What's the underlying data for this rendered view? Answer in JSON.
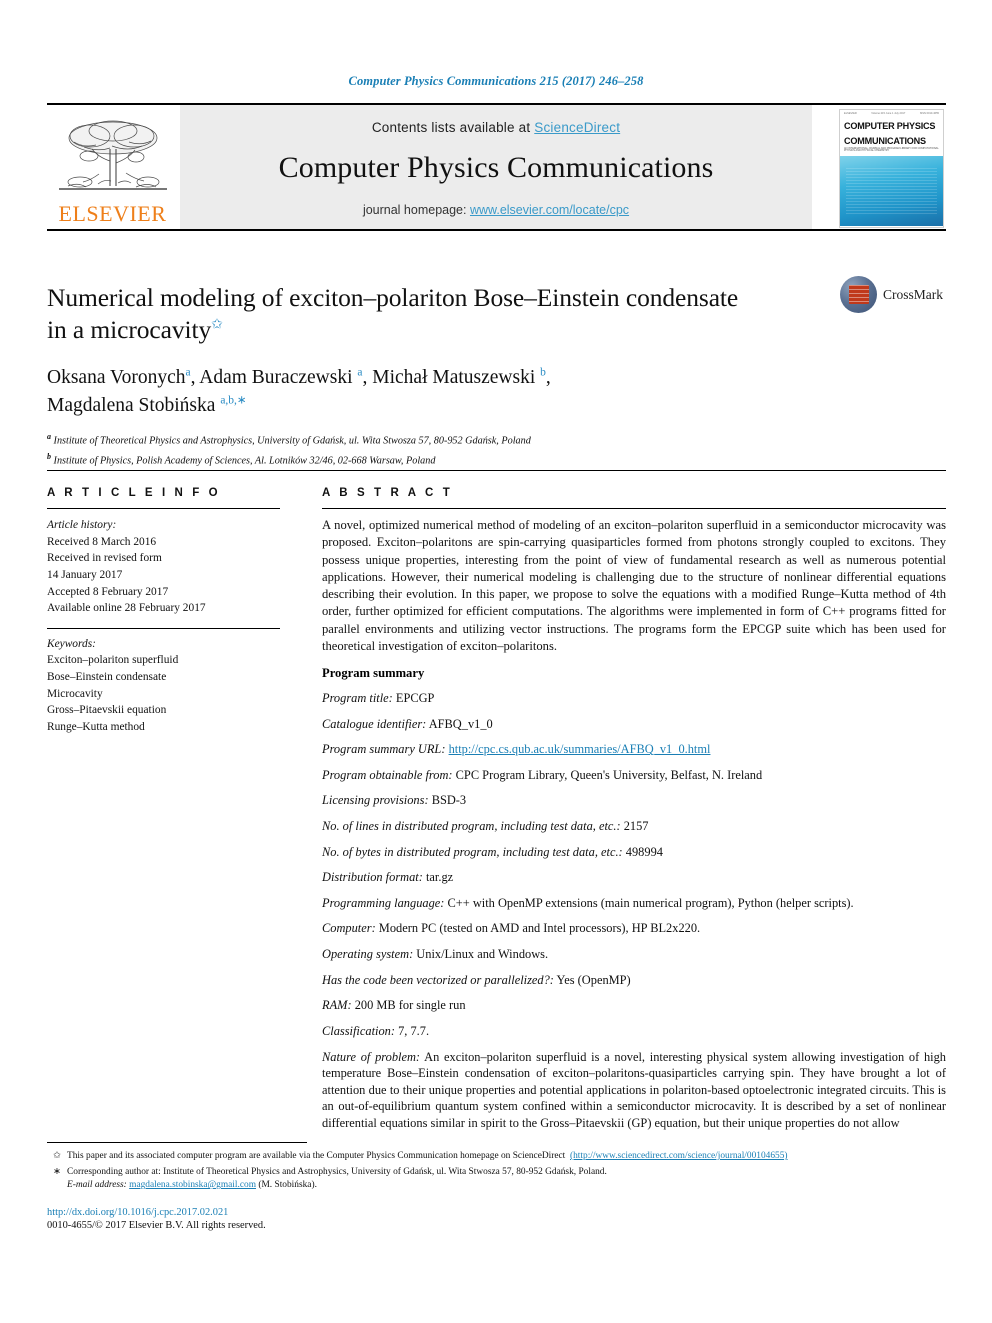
{
  "running_head": "Computer Physics Communications 215 (2017) 246–258",
  "masthead": {
    "publisher_name": "ELSEVIER",
    "contents_prefix": "Contents lists available at ",
    "contents_link": "ScienceDirect",
    "journal_name": "Computer Physics Communications",
    "homepage_prefix": "journal homepage: ",
    "homepage_link": "www.elsevier.com/locate/cpc",
    "cover": {
      "tiny_left": "ELSEVIER",
      "tiny_center": "Volume 215 June 1 July 2017",
      "tiny_right": "ISSN 0010-4655",
      "title_line1": "COMPUTER PHYSICS",
      "title_line2": "COMMUNICATIONS",
      "subtitle": "AN INTERNATIONAL JOURNAL AND PROGRAM LIBRARY FOR COMPUTATIONAL PHYSICS AND PHYSICAL CHEMISTRY"
    }
  },
  "article": {
    "title_line1": "Numerical modeling of exciton–polariton Bose–Einstein condensate",
    "title_line2": "in a microcavity",
    "title_mark": "✩",
    "authors_html": "Oksana Voronych<sup class=\"aff-sup\">a</sup>, Adam Buraczewski <sup class=\"aff-sup\">a</sup>, Michał Matuszewski <sup class=\"aff-sup\">b</sup>,<br>Magdalena Stobińska <sup class=\"aff-sup\">a,b,</sup><sup class=\"aff-sup\">∗</sup>",
    "affiliation_a": "Institute of Theoretical Physics and Astrophysics, University of Gdańsk, ul. Wita Stwosza 57, 80-952 Gdańsk, Poland",
    "affiliation_b": "Institute of Physics, Polish Academy of Sciences, Al. Lotników 32/46, 02-668 Warsaw, Poland",
    "crossmark_label": "CrossMark"
  },
  "article_info": {
    "heading": "A R T I C L E    I N F O",
    "history_label": "Article history:",
    "history": [
      "Received 8 March 2016",
      "Received in revised form",
      "14 January 2017",
      "Accepted 8 February 2017",
      "Available online 28 February 2017"
    ],
    "keywords_label": "Keywords:",
    "keywords": [
      "Exciton–polariton superfluid",
      "Bose–Einstein condensate",
      "Microcavity",
      "Gross–Pitaevskii equation",
      "Runge–Kutta method"
    ]
  },
  "abstract": {
    "heading": "A B S T R A C T",
    "paragraph": "A novel, optimized numerical method of modeling of an exciton–polariton superfluid in a semiconductor microcavity was proposed. Exciton–polaritons are spin-carrying quasiparticles formed from photons strongly coupled to excitons. They possess unique properties, interesting from the point of view of fundamental research as well as numerous potential applications. However, their numerical modeling is challenging due to the structure of nonlinear differential equations describing their evolution. In this paper, we propose to solve the equations with a modified Runge–Kutta method of 4th order, further optimized for efficient computations. The algorithms were implemented in form of C++ programs fitted for parallel environments and utilizing vector instructions. The programs form the EPCGP suite which has been used for theoretical investigation of exciton–polaritons."
  },
  "program_summary": {
    "heading": "Program summary",
    "items": [
      {
        "label": "Program title:",
        "value": " EPCGP"
      },
      {
        "label": "Catalogue identifier:",
        "value": " AFBQ_v1_0"
      },
      {
        "label": "Program summary URL:",
        "value": " ",
        "link": "http://cpc.cs.qub.ac.uk/summaries/AFBQ_v1_0.html"
      },
      {
        "label": "Program obtainable from:",
        "value": " CPC Program Library, Queen's University, Belfast, N. Ireland"
      },
      {
        "label": "Licensing provisions:",
        "value": " BSD-3"
      },
      {
        "label": "No. of lines in distributed program, including test data, etc.:",
        "value": " 2157"
      },
      {
        "label": "No. of bytes in distributed program, including test data, etc.:",
        "value": " 498994"
      },
      {
        "label": "Distribution format:",
        "value": " tar.gz"
      },
      {
        "label": "Programming language:",
        "value": " C++ with OpenMP extensions (main numerical program), Python (helper scripts)."
      },
      {
        "label": "Computer:",
        "value": " Modern PC (tested on AMD and Intel processors), HP BL2x220."
      },
      {
        "label": "Operating system:",
        "value": " Unix/Linux and Windows."
      },
      {
        "label": "Has the code been vectorized or parallelized?:",
        "value": " Yes (OpenMP)"
      },
      {
        "label": "RAM:",
        "value": " 200 MB for single run"
      },
      {
        "label": "Classification:",
        "value": " 7, 7.7."
      },
      {
        "label": "Nature of problem:",
        "value": " An exciton–polariton superfluid is a novel, interesting physical system allowing investigation of high temperature Bose–Einstein condensation of exciton–polaritons-quasiparticles carrying spin. They have brought a lot of attention due to their unique properties and potential applications in polariton-based optoelectronic integrated circuits. This is an out-of-equilibrium quantum system confined within a semiconductor microcavity. It is described by a set of nonlinear differential equations similar in spirit to the Gross–Pitaevskii (GP) equation, but their unique properties do not allow"
      }
    ]
  },
  "footnotes": {
    "note1_mark": "✩",
    "note1_text_a": "This paper and its associated computer program are available via the Computer Physics Communication homepage on ScienceDirect",
    "note1_link": "(http://www.sciencedirect.com/science/journal/00104655)",
    "note2_mark": "∗",
    "note2_text": "Corresponding author at: Institute of Theoretical Physics and Astrophysics, University of Gdańsk, ul. Wita Stwosza 57, 80-952 Gdańsk, Poland.",
    "email_label": "E-mail address:",
    "email_link": "magdalena.stobinska@gmail.com",
    "email_suffix": " (M. Stobińska).",
    "doi": "http://dx.doi.org/10.1016/j.cpc.2017.02.021",
    "copyright": "0010-4655/© 2017 Elsevier B.V. All rights reserved."
  },
  "colors": {
    "link_blue": "#1a7fb5",
    "sd_blue": "#3a9ac9",
    "elsevier_orange": "#ee7f1a",
    "crossmark_red": "#c0391b"
  }
}
